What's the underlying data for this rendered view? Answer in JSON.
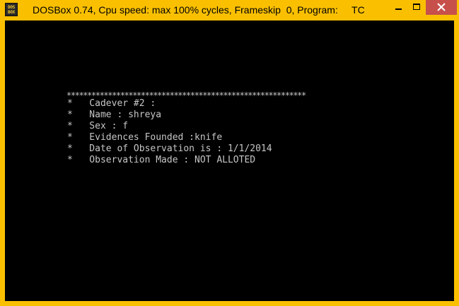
{
  "window": {
    "title": "DOSBox 0.74, Cpu speed: max 100% cycles, Frameskip  0, Program:     TC",
    "icon_label": "DOS BOX",
    "icon": "dosbox-icon",
    "controls": {
      "minimize_icon": "minimize-icon",
      "maximize_icon": "maximize-icon",
      "close_icon": "close-icon"
    },
    "colors": {
      "frame": "#fac000",
      "close_button": "#c7504b",
      "screen_background": "#000000",
      "screen_text": "#c6c6c6"
    }
  },
  "screen": {
    "border": "**********************************************************",
    "lines": [
      "*   Cadever #2 :",
      "*   Name : shreya",
      "*   Sex : f",
      "*   Evidences Founded :knife",
      "*   Date of Observation is : 1/1/2014",
      "*   Observation Made : NOT ALLOTED"
    ]
  }
}
